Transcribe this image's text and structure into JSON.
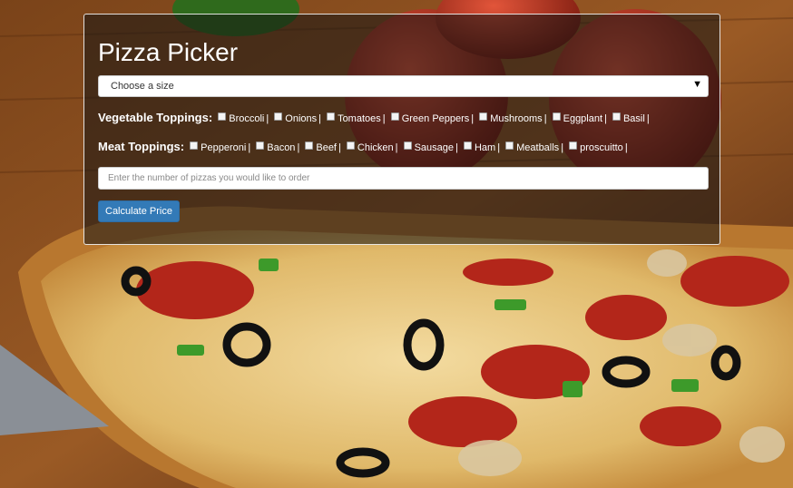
{
  "app": {
    "title": "Pizza Picker"
  },
  "size_select": {
    "selected": "Choose a size"
  },
  "vegetable_toppings": {
    "label": "Vegetable Toppings:",
    "items": [
      "Broccoli",
      "Onions",
      "Tomatoes",
      "Green Peppers",
      "Mushrooms",
      "Eggplant",
      "Basil"
    ]
  },
  "meat_toppings": {
    "label": "Meat Toppings:",
    "items": [
      "Pepperoni",
      "Bacon",
      "Beef",
      "Chicken",
      "Sausage",
      "Ham",
      "Meatballs",
      "proscuitto"
    ]
  },
  "quantity": {
    "placeholder": "Enter the number of pizzas you would like to order",
    "value": ""
  },
  "calculate_button": {
    "label": "Calculate Price"
  },
  "separator": "|",
  "icons": {
    "dropdown": "chevron-down-icon"
  },
  "colors": {
    "button": "#337ab7",
    "panel_bg": "rgba(20,20,20,0.55)"
  }
}
